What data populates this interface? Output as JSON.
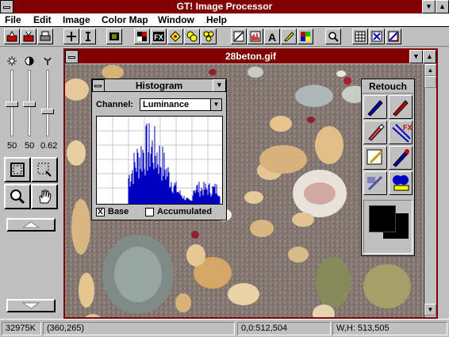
{
  "app": {
    "title": "GT! Image Processor"
  },
  "menu": [
    "File",
    "Edit",
    "Image",
    "Color Map",
    "Window",
    "Help"
  ],
  "toolbar": {
    "buttons": [
      "open-icon",
      "save-icon",
      "print-icon",
      "crosshair-icon",
      "text-cursor-icon",
      "film-icon",
      "checker-icon",
      "fx-icon",
      "diamond-icon",
      "coins-icon",
      "line-icon",
      "chart-icon",
      "letter-a-icon",
      "pencil-icon",
      "color-grid-icon",
      "zoom-icon",
      "grid-icon",
      "arrows-icon",
      "ruler-icon"
    ]
  },
  "left_panel": {
    "slider_values": [
      "50",
      "50",
      "0.62"
    ],
    "slider_icons": [
      "brightness-icon",
      "contrast-icon",
      "gamma-icon"
    ]
  },
  "image_window": {
    "title": "28beton.gif"
  },
  "histogram": {
    "title": "Histogram",
    "channel_label": "Channel:",
    "channel_value": "Luminance",
    "base_label": "Base",
    "base_checked": true,
    "base_mark": "X",
    "accumulated_label": "Accumulated",
    "accumulated_checked": false
  },
  "retouch": {
    "title": "Retouch",
    "tools": [
      "brush-blue-icon",
      "brush-red-icon",
      "pen-red-icon",
      "fx-eraser-icon",
      "palette-icon",
      "brush-blue2-icon",
      "filter-icon",
      "stamp-icon"
    ]
  },
  "status": {
    "memory": "32975K",
    "cursor": "(360,265)",
    "origin": "0,0:512,504",
    "size": "W,H: 513,505"
  },
  "colors": {
    "title_bar": "#800000",
    "face": "#c0c0c0",
    "histogram_bars": "#0000c0"
  }
}
